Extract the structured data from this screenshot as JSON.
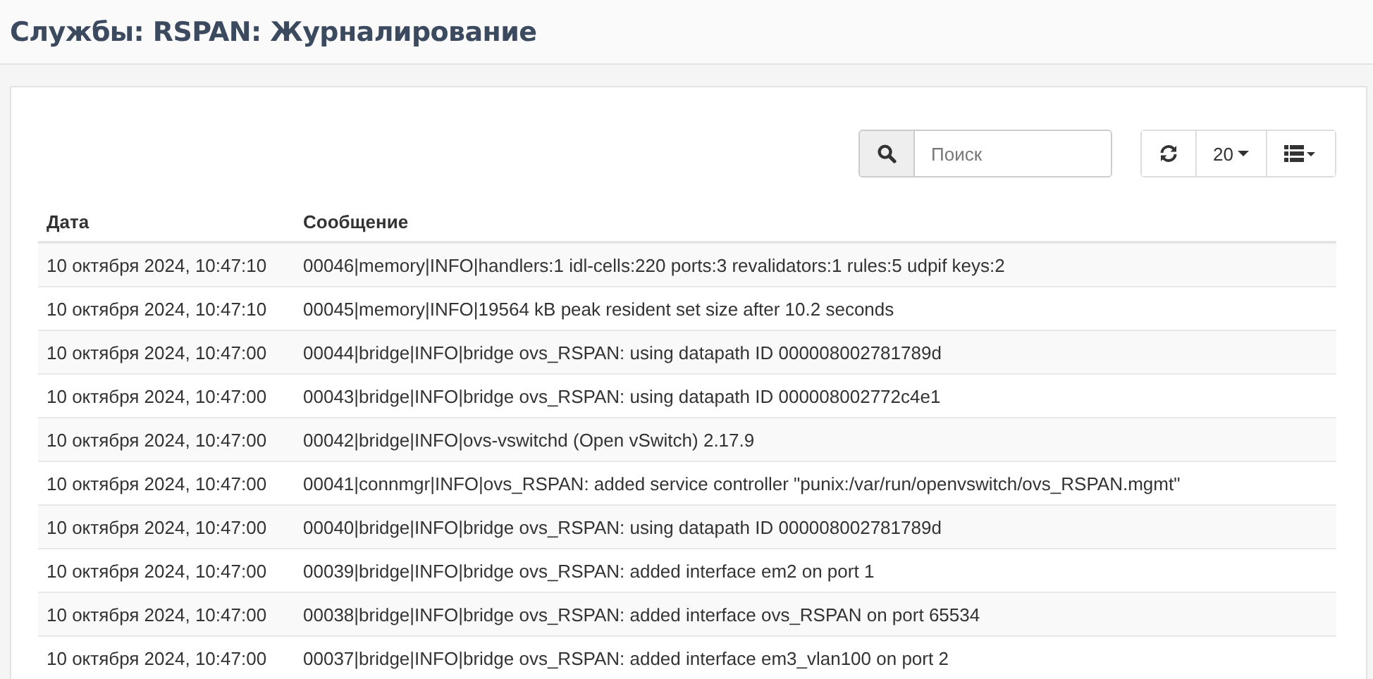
{
  "page_title": "Службы: RSPAN: Журналирование",
  "toolbar": {
    "search": {
      "placeholder": "Поиск"
    },
    "page_size": "20"
  },
  "table": {
    "columns": [
      "Дата",
      "Сообщение"
    ],
    "rows": [
      {
        "date": "10 октября 2024, 10:47:10",
        "message": "00046|memory|INFO|handlers:1 idl-cells:220 ports:3 revalidators:1 rules:5 udpif keys:2"
      },
      {
        "date": "10 октября 2024, 10:47:10",
        "message": "00045|memory|INFO|19564 kB peak resident set size after 10.2 seconds"
      },
      {
        "date": "10 октября 2024, 10:47:00",
        "message": "00044|bridge|INFO|bridge ovs_RSPAN: using datapath ID 000008002781789d"
      },
      {
        "date": "10 октября 2024, 10:47:00",
        "message": "00043|bridge|INFO|bridge ovs_RSPAN: using datapath ID 000008002772c4e1"
      },
      {
        "date": "10 октября 2024, 10:47:00",
        "message": "00042|bridge|INFO|ovs-vswitchd (Open vSwitch) 2.17.9"
      },
      {
        "date": "10 октября 2024, 10:47:00",
        "message": "00041|connmgr|INFO|ovs_RSPAN: added service controller \"punix:/var/run/openvswitch/ovs_RSPAN.mgmt\""
      },
      {
        "date": "10 октября 2024, 10:47:00",
        "message": "00040|bridge|INFO|bridge ovs_RSPAN: using datapath ID 000008002781789d"
      },
      {
        "date": "10 октября 2024, 10:47:00",
        "message": "00039|bridge|INFO|bridge ovs_RSPAN: added interface em2 on port 1"
      },
      {
        "date": "10 октября 2024, 10:47:00",
        "message": "00038|bridge|INFO|bridge ovs_RSPAN: added interface ovs_RSPAN on port 65534"
      },
      {
        "date": "10 октября 2024, 10:47:00",
        "message": "00037|bridge|INFO|bridge ovs_RSPAN: added interface em3_vlan100 on port 2"
      }
    ]
  }
}
